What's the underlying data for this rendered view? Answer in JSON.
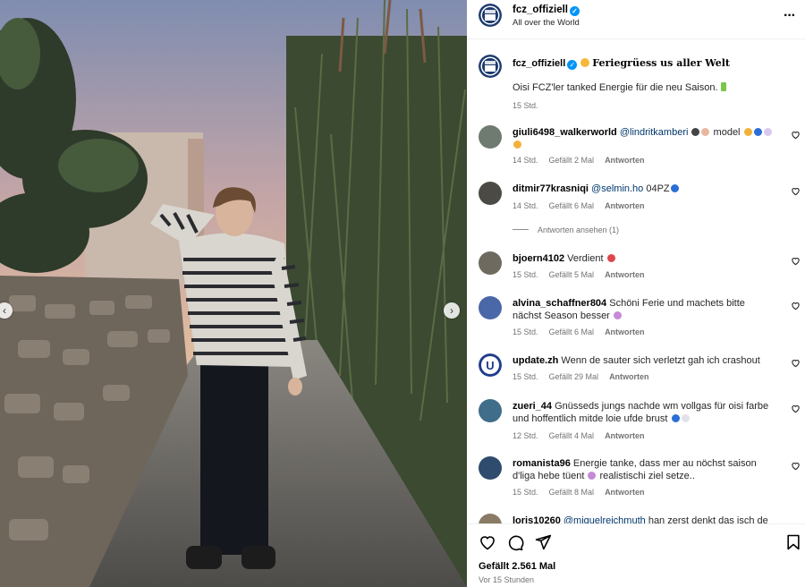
{
  "post": {
    "username": "fcz_offiziell",
    "location": "All over the World",
    "caption_title": "Feriegrüess us aller Welt",
    "caption_body": "Oisi FCZ'ler tanked Energie für die neu Saison.",
    "caption_time": "15 Std.",
    "likes": "Gefällt 2.561 Mal",
    "posted_ago": "Vor 15 Stunden"
  },
  "icons": {
    "more": "more-options-icon",
    "verified": "verified-badge-icon",
    "like": "heart-icon",
    "comment": "comment-icon",
    "share": "share-icon",
    "save": "bookmark-icon",
    "prev": "chevron-left-icon",
    "next": "chevron-right-icon"
  },
  "labels": {
    "reply": "Antworten",
    "view_replies": "Antworten ansehen (1)"
  },
  "comments": [
    {
      "user": "giuli6498_walkerworld",
      "mention": "@lindritkamberi",
      "text": " model",
      "time": "14 Std.",
      "likes": "Gefällt 2 Mal",
      "reply": "Antworten"
    },
    {
      "user": "ditmir77krasniqi",
      "mention": "@selmin.ho",
      "text": " 04PZ",
      "time": "14 Std.",
      "likes": "Gefällt 6 Mal",
      "reply": "Antworten"
    },
    {
      "user": "bjoern4102",
      "mention": "",
      "text": "Verdient",
      "time": "15 Std.",
      "likes": "Gefällt 5 Mal",
      "reply": "Antworten"
    },
    {
      "user": "alvina_schaffner804",
      "mention": "",
      "text": "Schöni Ferie und machets bitte nächst Season besser",
      "time": "15 Std.",
      "likes": "Gefällt 6 Mal",
      "reply": "Antworten"
    },
    {
      "user": "update.zh",
      "mention": "",
      "text": "Wenn de sauter sich verletzt gah ich crashout",
      "time": "15 Std.",
      "likes": "Gefällt 29 Mal",
      "reply": "Antworten"
    },
    {
      "user": "zueri_44",
      "mention": "",
      "text": "Gnüsseds jungs nachde wm vollgas für oisi farbe und hoffentlich mitde loie ufde brust",
      "time": "12 Std.",
      "likes": "Gefällt 4 Mal",
      "reply": "Antworten"
    },
    {
      "user": "romanista96",
      "mention": "",
      "text": "Energie tanke, dass mer au nöchst saison d'liga hebe tüent",
      "text2": " realistischi ziel setze..",
      "time": "15 Std.",
      "likes": "Gefällt 8 Mal",
      "reply": "Antworten"
    },
    {
      "user": "loris10260",
      "mention": "@miguelreichmuth",
      "text": " han zerst denkt das isch de",
      "time": "",
      "likes": "",
      "reply": ""
    }
  ]
}
